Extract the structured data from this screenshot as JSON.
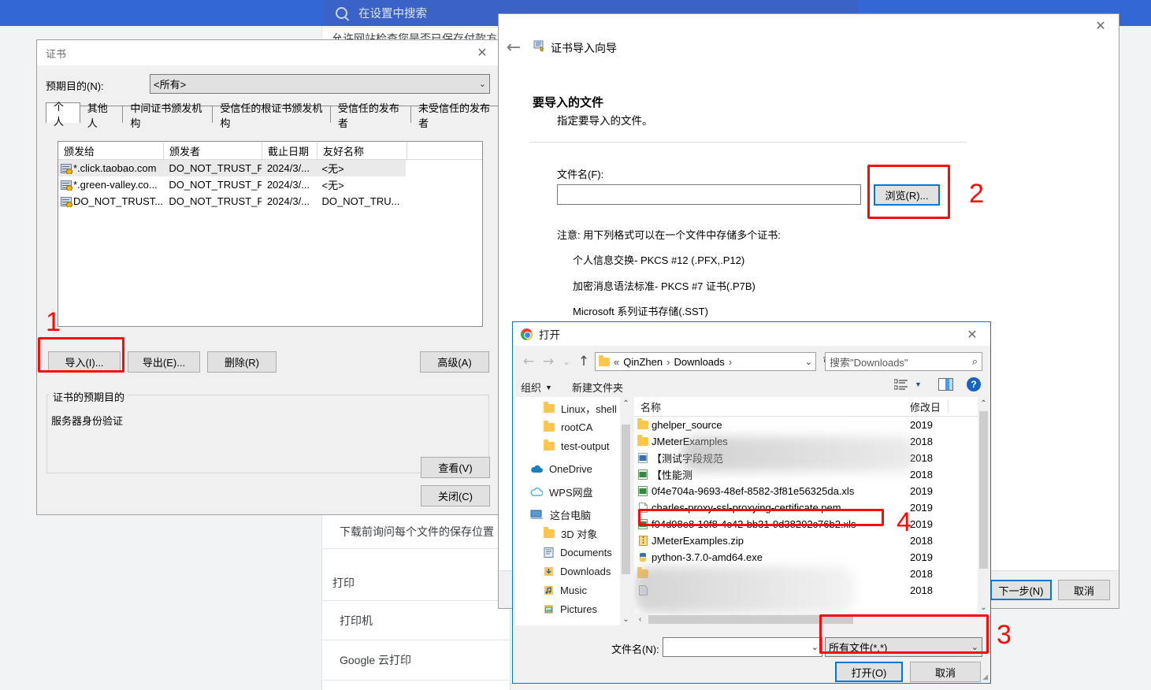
{
  "chrome": {
    "search_placeholder": "在设置中搜索",
    "search_icon": "search-icon",
    "items": [
      {
        "text": "允许网站检查您是否已保存付款方式"
      },
      {
        "text": "下载前询问每个文件的保存位置"
      }
    ],
    "print_section": "打印",
    "print_rows": [
      "打印机",
      "Google 云打印"
    ]
  },
  "cert_dialog": {
    "title": "证书",
    "close_icon": "close-icon",
    "purpose_label": "预期目的(N):",
    "purpose_value": "<所有>",
    "tabs": [
      {
        "label": "个人",
        "active": true
      },
      {
        "label": "其他人",
        "active": false
      },
      {
        "label": "中间证书颁发机构",
        "active": false
      },
      {
        "label": "受信任的根证书颁发机构",
        "active": false
      },
      {
        "label": "受信任的发布者",
        "active": false
      },
      {
        "label": "未受信任的发布者",
        "active": false
      }
    ],
    "columns": [
      "颁发给",
      "颁发者",
      "截止日期",
      "友好名称"
    ],
    "rows": [
      {
        "issued_to": "*.click.taobao.com",
        "issued_by": "DO_NOT_TRUST_Fi...",
        "expiry": "2024/3/...",
        "friendly": "<无>",
        "selected": true
      },
      {
        "issued_to": "*.green-valley.co...",
        "issued_by": "DO_NOT_TRUST_Fi...",
        "expiry": "2024/3/...",
        "friendly": "<无>",
        "selected": false
      },
      {
        "issued_to": "DO_NOT_TRUST...",
        "issued_by": "DO_NOT_TRUST_Fi...",
        "expiry": "2024/3/...",
        "friendly": "DO_NOT_TRU...",
        "selected": false
      }
    ],
    "buttons": {
      "import": "导入(I)...",
      "export": "导出(E)...",
      "remove": "删除(R)",
      "advanced": "高级(A)",
      "view": "查看(V)",
      "close": "关闭(C)"
    },
    "group_label": "证书的预期目的",
    "group_value": "服务器身份验证"
  },
  "wizard": {
    "back_icon": "back-arrow-icon",
    "wizard_icon": "certificate-wizard-icon",
    "title": "证书导入向导",
    "close_icon": "close-icon",
    "heading": "要导入的文件",
    "subheading": "指定要导入的文件。",
    "filename_label": "文件名(F):",
    "filename_value": "",
    "browse_button": "浏览(R)...",
    "note_title": "注意: 用下列格式可以在一个文件中存储多个证书:",
    "note_items": [
      "个人信息交换- PKCS #12 (.PFX,.P12)",
      "加密消息语法标准- PKCS #7 证书(.P7B)",
      "Microsoft 系列证书存储(.SST)"
    ],
    "next_button": "下一步(N)",
    "cancel_button": "取消"
  },
  "open_dialog": {
    "app_icon": "chrome-logo-icon",
    "title": "打开",
    "close_icon": "close-icon",
    "nav": {
      "back_icon": "back-arrow-icon",
      "forward_icon": "forward-arrow-icon",
      "recent_icon": "chevron-down-icon",
      "up_icon": "up-arrow-icon"
    },
    "breadcrumb": {
      "folder_icon": "folder-icon",
      "prefix": "«",
      "parts": [
        "QinZhen",
        "Downloads"
      ],
      "separator": "›",
      "dropdown_icon": "chevron-down-icon",
      "refresh_icon": "refresh-icon"
    },
    "search_placeholder": "搜索\"Downloads\"",
    "search_icon": "search-icon",
    "toolbar": {
      "organize": "组织",
      "new_folder": "新建文件夹",
      "view_icon": "view-list-icon",
      "view_dropdown_icon": "chevron-down-icon",
      "preview_icon": "preview-pane-icon",
      "help_icon": "help-icon"
    },
    "nav_items": [
      {
        "label": "Linux，shell",
        "icon": "folder-icon",
        "indent": 2
      },
      {
        "label": "rootCA",
        "icon": "folder-icon",
        "indent": 2
      },
      {
        "label": "test-output",
        "icon": "folder-icon",
        "indent": 2
      },
      {
        "label": "OneDrive",
        "icon": "onedrive-icon",
        "indent": 1
      },
      {
        "label": "WPS网盘",
        "icon": "cloud-icon",
        "indent": 1
      },
      {
        "label": "这台电脑",
        "icon": "this-pc-icon",
        "indent": 1
      },
      {
        "label": "3D 对象",
        "icon": "3d-objects-icon",
        "indent": 2
      },
      {
        "label": "Documents",
        "icon": "documents-icon",
        "indent": 2
      },
      {
        "label": "Downloads",
        "icon": "downloads-icon",
        "indent": 2
      },
      {
        "label": "Music",
        "icon": "music-icon",
        "indent": 2
      },
      {
        "label": "Pictures",
        "icon": "pictures-icon",
        "indent": 2
      }
    ],
    "columns": {
      "name": "名称",
      "modified": "修改日"
    },
    "files": [
      {
        "name": "ghelper_source",
        "icon": "folder-icon",
        "date": "2019",
        "blurred": false
      },
      {
        "name": "JMeterExamples",
        "icon": "folder-icon",
        "date": "2018",
        "blurred": false
      },
      {
        "name": "【测试字段规范",
        "icon": "word-icon",
        "date": "2018",
        "blurred": true
      },
      {
        "name": "【性能测",
        "icon": "excel-icon",
        "date": "2018",
        "blurred": true
      },
      {
        "name": "0f4e704a-9693-48ef-8582-3f81e56325da.xls",
        "icon": "excel-icon",
        "date": "2019",
        "blurred": false
      },
      {
        "name": "charles-proxy-ssl-proxying-certificate.pem",
        "icon": "file-icon",
        "date": "2019",
        "blurred": false,
        "highlighted": true
      },
      {
        "name": "f04d98e8-10f8-4c42-bb31-9d38202c76b2.xls",
        "icon": "excel-icon",
        "date": "2019",
        "blurred": false
      },
      {
        "name": "JMeterExamples.zip",
        "icon": "zip-icon",
        "date": "2018",
        "blurred": false
      },
      {
        "name": "python-3.7.0-amd64.exe",
        "icon": "python-icon",
        "date": "2019",
        "blurred": false
      },
      {
        "name": "",
        "icon": "folder-icon",
        "date": "2018",
        "blurred": true
      },
      {
        "name": "",
        "icon": "file-icon",
        "date": "2018",
        "blurred": true
      }
    ],
    "filename_label": "文件名(N):",
    "filename_value": "",
    "filetype_value": "所有文件(*.*)",
    "open_button": "打开(O)",
    "cancel_button": "取消"
  },
  "annotations": [
    {
      "number": "1"
    },
    {
      "number": "2"
    },
    {
      "number": "3"
    },
    {
      "number": "4"
    }
  ],
  "colors": {
    "accent_blue": "#3367d6",
    "annotation_red": "#fb0a0a",
    "focus_blue": "#0078d7"
  }
}
